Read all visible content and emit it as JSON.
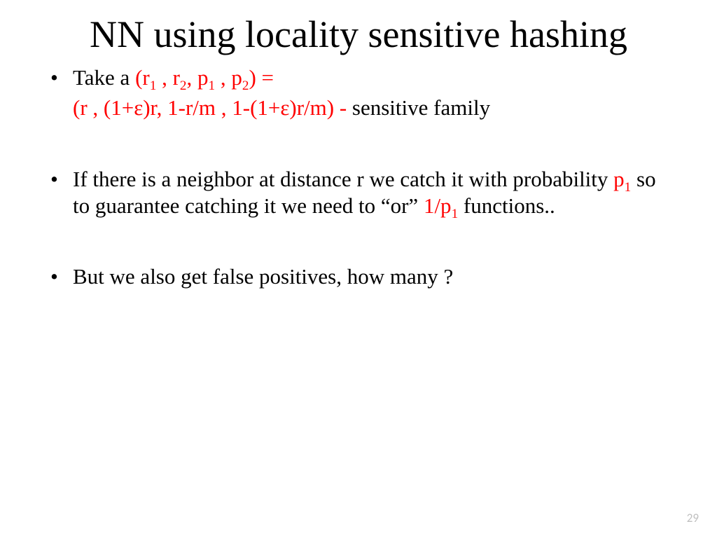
{
  "title": "NN using locality sensitive hashing",
  "bullet1": {
    "prefix": "Take a ",
    "tuple_open": "(r",
    "s1": "1",
    "sep1": " , r",
    "s2": "2",
    "sep2": ", p",
    "s3": "1",
    "sep3": " , p",
    "s4": "2",
    "tuple_close": ") ="
  },
  "bullet1_sub": {
    "tuple": "(r , (1+ε)r, 1-r/m , 1-(1+ε)r/m) - ",
    "suffix": "sensitive family"
  },
  "bullet2": {
    "t1": "If there is a neighbor at distance r we catch it with probability ",
    "p": "p",
    "psub": "1",
    "t2": " so to guarantee catching it we need to “or” ",
    "q": "1/p",
    "qsub": "1",
    "t3": " functions.."
  },
  "bullet3": "But we also get false positives, how many ?",
  "page_number": "29"
}
